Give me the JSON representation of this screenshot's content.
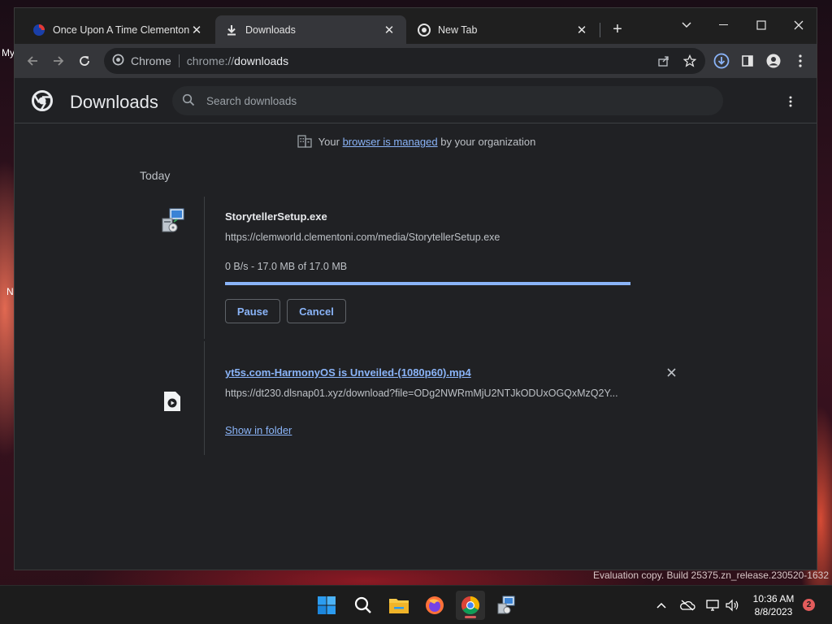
{
  "desktop": {
    "labels": [
      "My",
      "N"
    ]
  },
  "browser": {
    "tabs": [
      {
        "title": "Once Upon A Time Clementoni Un",
        "favicon": "clementoni-icon",
        "active": false
      },
      {
        "title": "Downloads",
        "favicon": "download-icon",
        "active": true
      },
      {
        "title": "New Tab",
        "favicon": "chrome-icon",
        "active": false
      }
    ],
    "toolbar": {
      "site_chip": "Chrome",
      "url_scheme": "chrome://",
      "url_host": "downloads"
    }
  },
  "downloads_page": {
    "title": "Downloads",
    "search_placeholder": "Search downloads",
    "managed_notice": {
      "prefix": "Your",
      "link": "browser is managed",
      "suffix": "by your organization"
    },
    "date_group": "Today",
    "items": [
      {
        "filename": "StorytellerSetup.exe",
        "url": "https://clemworld.clementoni.com/media/StorytellerSetup.exe",
        "status": "0 B/s - 17.0 MB of 17.0 MB",
        "progress": 1.0,
        "actions": [
          "Pause",
          "Cancel"
        ],
        "icon": "installer-icon"
      },
      {
        "filename": "yt5s.com-HarmonyOS is Unveiled-(1080p60).mp4",
        "url": "https://dt230.dlsnap01.xyz/download?file=ODg2NWRmMjU2NTJkODUxOGQxMzQ2Y...",
        "link": "Show in folder",
        "icon": "video-file-icon"
      }
    ]
  },
  "watermark": "Evaluation copy. Build 25375.zn_release.230520-1632",
  "taskbar": {
    "clock_time": "10:36 AM",
    "clock_date": "8/8/2023",
    "notification_count": "2"
  },
  "colors": {
    "accent": "#8ab4f8",
    "bg": "#202124",
    "toolbar": "#35363a",
    "badge": "#e35c5c"
  }
}
